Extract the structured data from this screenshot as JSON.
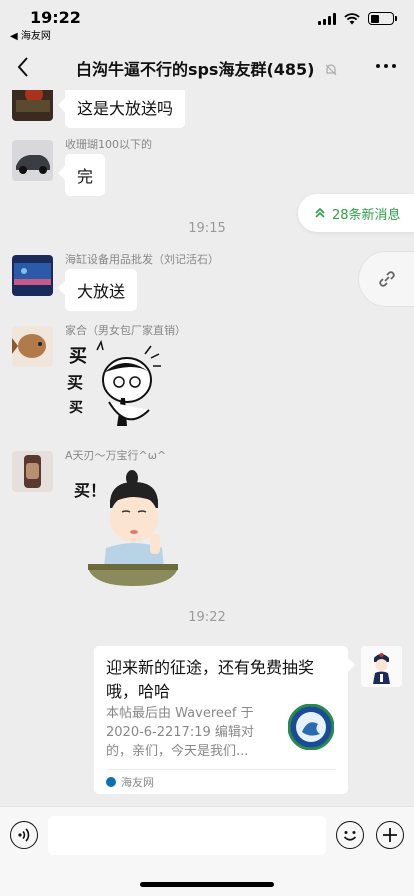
{
  "status": {
    "time": "19:22",
    "back_app": "◀ 海友网"
  },
  "nav": {
    "title": "白沟牛逼不行的sps海友群(485)"
  },
  "floating": {
    "new_messages": "28条新消息"
  },
  "messages": [
    {
      "sender": "",
      "text": "这是大放送吗"
    },
    {
      "sender": "收珊瑚100以下的",
      "text": "完"
    },
    {
      "time_separator": "19:15"
    },
    {
      "sender": "海缸设备用品批发（刘记活石）",
      "text": "大放送"
    },
    {
      "sender": "家合（男女包厂家直销）",
      "sticker_text": [
        "买",
        "买",
        "买"
      ]
    },
    {
      "sender": "A天刃～万宝行^ω^",
      "sticker_text": "买！"
    },
    {
      "time_separator": "19:22"
    }
  ],
  "card": {
    "title": "迎来新的征途，还有免费抽奖哦，哈哈",
    "description": "本帖最后由 Wavereef 于 2020-6-2217:19 编辑对的，亲们，今天是我们...",
    "source": "海友网"
  },
  "input": {
    "placeholder": ""
  },
  "colors": {
    "background": "#ededed",
    "accent_green": "#2ba245",
    "bubble": "#ffffff"
  }
}
